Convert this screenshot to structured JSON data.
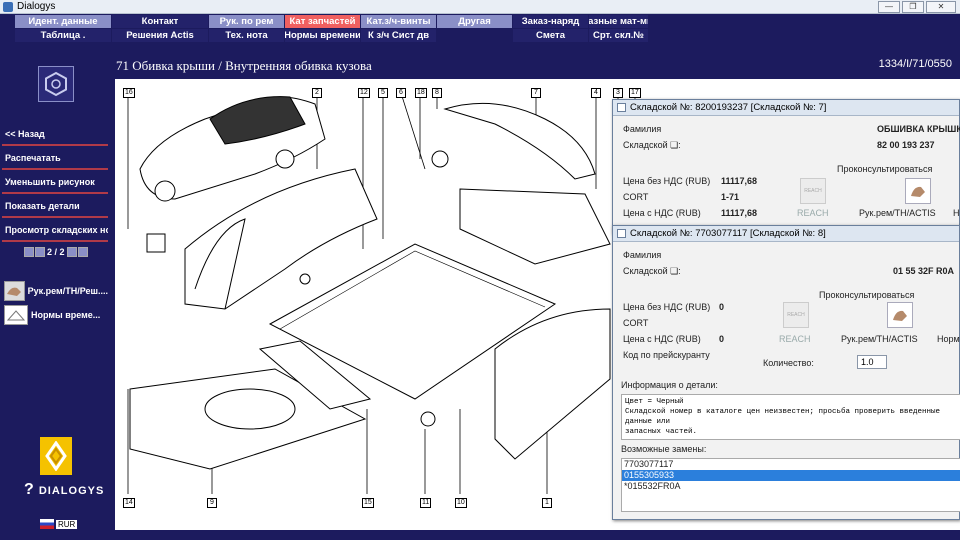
{
  "window": {
    "title": "Dialogys"
  },
  "menu": {
    "row1": [
      "Идент. данные",
      "Контакт",
      "Рук. по рем",
      "Кат запчастей",
      "Кат.з/ч-винты",
      "Другая",
      "Заказ-наряд",
      "Разные мат-мы"
    ],
    "row2": [
      "Таблица .",
      "Решения Actis",
      "Тех. нота",
      "Нормы времени",
      "К з/ч Сист дв",
      "",
      "Смета",
      "Срт. скл.№"
    ],
    "active_index": 3
  },
  "sidebar": {
    "back": "<< Назад",
    "print": "Распечатать",
    "shrink": "Уменьшить рисунок",
    "show_details": "Показать детали",
    "view_stock": "Просмотр складских но...",
    "pager_text": "2 / 2",
    "tool1": "Рук.рем/TH/Реш....",
    "tool2": "Нормы време...",
    "brand": "DIALOGYS",
    "lang": "RUR"
  },
  "header": {
    "title": "71 Обивка крыши / Внутренняя обивка кузова",
    "code": "1334/I/71/0550"
  },
  "diagram": {
    "labels": [
      "16",
      "2",
      "12",
      "5",
      "6",
      "18",
      "8",
      "7",
      "4",
      "3",
      "17",
      "14",
      "9",
      "15",
      "11",
      "10",
      "1"
    ]
  },
  "dialog1": {
    "title": "Складской №: 8200193237 [Складской №: 7]",
    "family_label": "Фамилия",
    "family_value": "ОБШИВКА КРЫШКИ",
    "stock_label": "Складской ❏:",
    "stock_value": "82 00 193 237",
    "consult": "Проконсультироваться",
    "price_no_vat_label": "Цена без НДС (RUB)",
    "price_no_vat": "11117,68",
    "cort_label": "CORT",
    "cort_value": "1-71",
    "price_vat_label": "Цена с НДС (RUB)",
    "price_vat": "11117,68",
    "reach": "REACH",
    "manual": "Рук.рем/TH/ACTIS",
    "extra": "Н"
  },
  "dialog2": {
    "title": "Складской №: 7703077117 [Складской №: 8]",
    "family_label": "Фамилия",
    "stock_label": "Складской ❏:",
    "stock_value": "01 55 32F R0A",
    "consult": "Проконсультироваться",
    "price_no_vat_label": "Цена без НДС (RUB)",
    "price_no_vat": "0",
    "cort_label": "CORT",
    "price_vat_label": "Цена с НДС (RUB)",
    "price_vat": "0",
    "reach": "REACH",
    "manual": "Рук.рем/TH/ACTIS",
    "extra": "Норм",
    "price_code_label": "Код по прейскуранту",
    "quantity_label": "Количество:",
    "quantity_value": "1.0",
    "info_label": "Информация о детали:",
    "info_text": "Цвет = Черный\nСкладской номер в каталоге цен неизвестен; просьба проверить введенные данные или\nзапасных частей.",
    "replacements_label": "Возможные замены:",
    "replacements": [
      "7703077117",
      "0155305933",
      "*015532FR0A"
    ],
    "selected_index": 1
  },
  "colors": {
    "background": "#1c1b5e",
    "menu_light": "#8a8fc7",
    "menu_active": "#f06060",
    "sidebar_rule": "#b03a48"
  }
}
